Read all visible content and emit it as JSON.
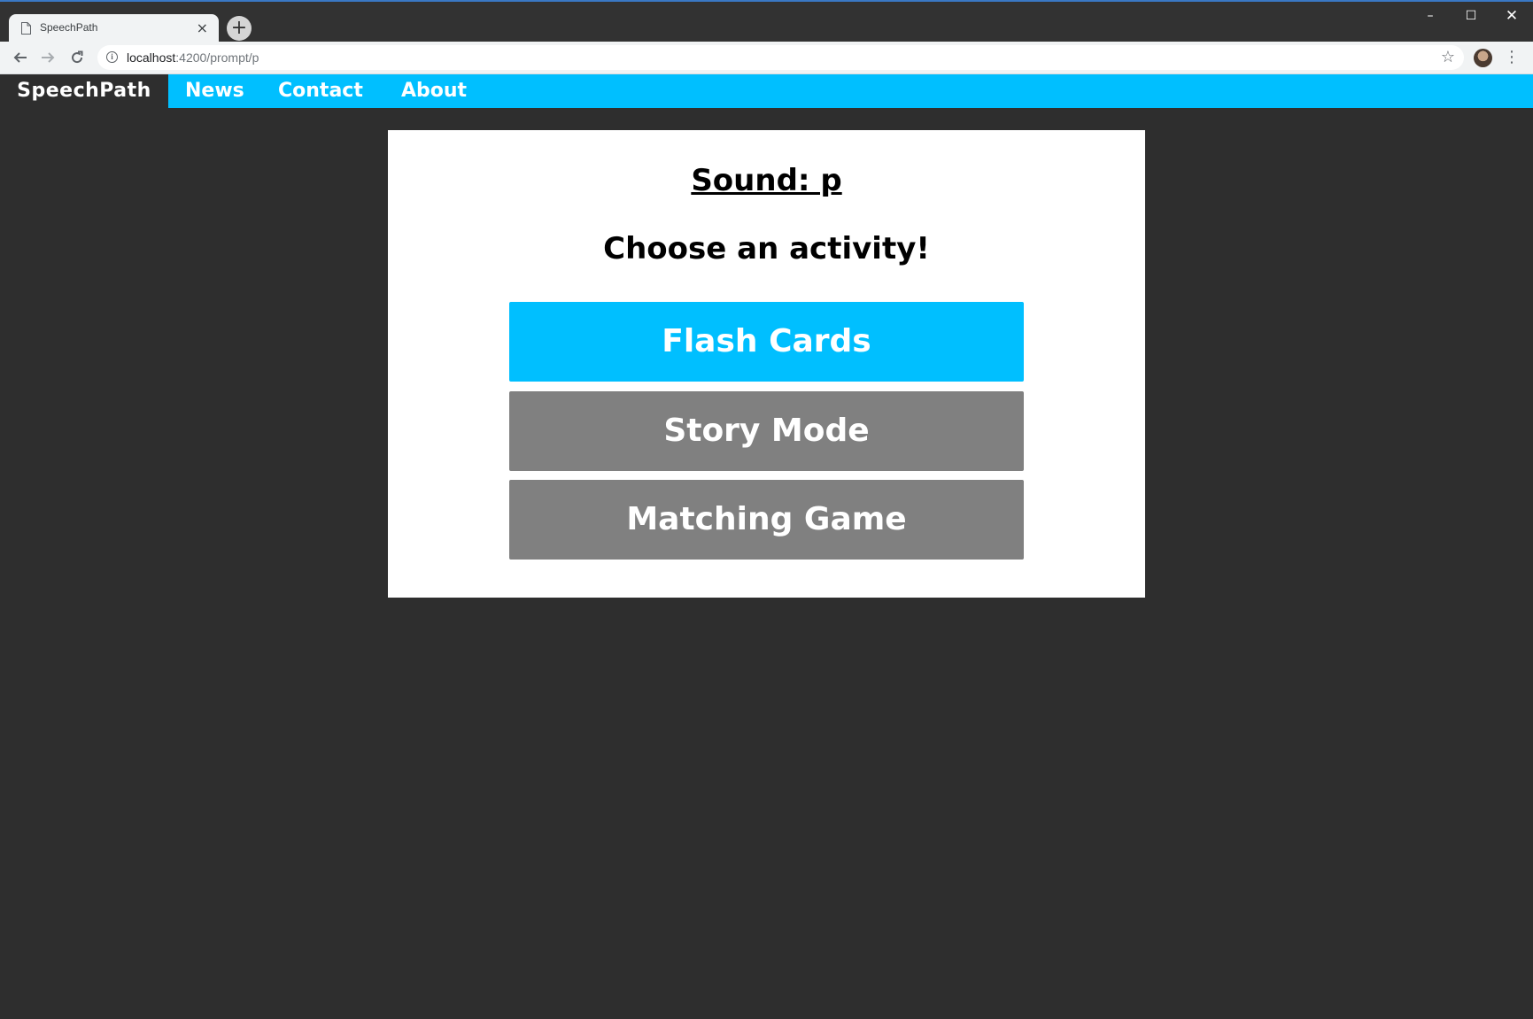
{
  "browser": {
    "tab_title": "SpeechPath",
    "tab_close": "×",
    "new_tab": "+",
    "url_host": "localhost",
    "url_path": ":4200/prompt/p",
    "window_controls": {
      "minimize": "–",
      "maximize": "☐",
      "close": "✕"
    }
  },
  "nav": {
    "brand": "SpeechPath",
    "links": [
      "News",
      "Contact",
      "About"
    ]
  },
  "main": {
    "sound_title": "Sound: p",
    "prompt": "Choose an activity!",
    "activities": [
      "Flash Cards",
      "Story Mode",
      "Matching Game"
    ]
  },
  "colors": {
    "accent": "#00bfff",
    "background": "#2e2e2e",
    "inactive_button": "#808080",
    "card": "#ffffff"
  },
  "icons": {
    "back": "arrow-left-icon",
    "forward": "arrow-right-icon",
    "reload": "reload-icon",
    "info": "info-icon",
    "bookmark": "star-icon",
    "menu": "kebab-menu-icon",
    "page": "page-icon"
  }
}
